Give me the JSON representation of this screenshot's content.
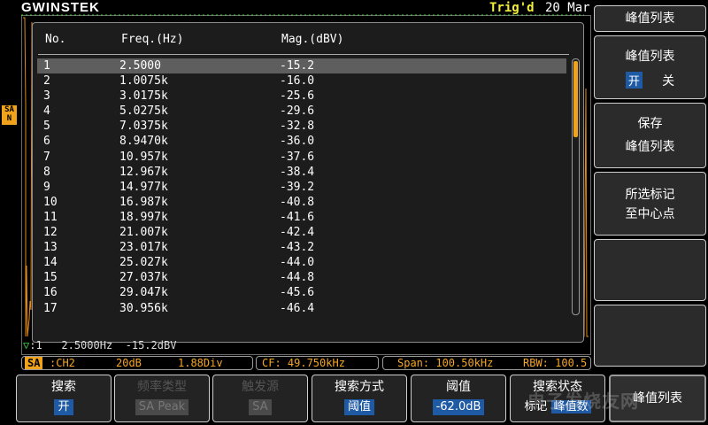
{
  "header": {
    "logo": "GWINSTEK",
    "trigger_status": "Trig'd",
    "date": "20 Mar"
  },
  "channel_marker": "SA\nN",
  "peak_table": {
    "col_no": "No.",
    "col_freq": "Freq.(Hz)",
    "col_mag": "Mag.(dBV)",
    "rows": [
      {
        "no": "1",
        "freq": "2.5000",
        "mag": "-15.2"
      },
      {
        "no": "2",
        "freq": "1.0075k",
        "mag": "-16.0"
      },
      {
        "no": "3",
        "freq": "3.0175k",
        "mag": "-25.6"
      },
      {
        "no": "4",
        "freq": "5.0275k",
        "mag": "-29.6"
      },
      {
        "no": "5",
        "freq": "7.0375k",
        "mag": "-32.8"
      },
      {
        "no": "6",
        "freq": "8.9470k",
        "mag": "-36.0"
      },
      {
        "no": "7",
        "freq": "10.957k",
        "mag": "-37.6"
      },
      {
        "no": "8",
        "freq": "12.967k",
        "mag": "-38.4"
      },
      {
        "no": "9",
        "freq": "14.977k",
        "mag": "-39.2"
      },
      {
        "no": "10",
        "freq": "16.987k",
        "mag": "-40.8"
      },
      {
        "no": "11",
        "freq": "18.997k",
        "mag": "-41.6"
      },
      {
        "no": "12",
        "freq": "21.007k",
        "mag": "-42.4"
      },
      {
        "no": "13",
        "freq": "23.017k",
        "mag": "-43.2"
      },
      {
        "no": "14",
        "freq": "25.027k",
        "mag": "-44.0"
      },
      {
        "no": "15",
        "freq": "27.037k",
        "mag": "-44.8"
      },
      {
        "no": "16",
        "freq": "29.047k",
        "mag": "-45.6"
      },
      {
        "no": "17",
        "freq": "30.956k",
        "mag": "-46.4"
      }
    ]
  },
  "marker_readout": {
    "index": ":1",
    "freq": "2.5000Hz",
    "mag": "-15.2dBV"
  },
  "status": {
    "sa_tag": "SA",
    "source": ":CH2",
    "scale": "20dB",
    "div": "1.88Div",
    "cf": "CF: 49.750kHz",
    "span": "Span: 100.50kHz",
    "rbw": "RBW: 100.5"
  },
  "right_menu": {
    "title": "峰值列表",
    "peak_list_label": "峰值列表",
    "on": "开",
    "off": "关",
    "save_line1": "保存",
    "save_line2": "峰值列表",
    "center_line1": "所选标记",
    "center_line2": "至中心点"
  },
  "bottom_menu": {
    "search_title": "搜索",
    "search_value": "开",
    "freq_type_title": "频率类型",
    "freq_type_value": "SA Peak",
    "trigger_source_title": "触发源",
    "trigger_source_value": "SA",
    "search_mode_title": "搜索方式",
    "search_mode_value": "阈值",
    "threshold_title": "阈值",
    "threshold_value": "-62.0dB",
    "search_state_title": "搜索状态",
    "search_state_prefix": "标记",
    "search_state_value": "峰值数",
    "peak_list_button": "峰值列表"
  },
  "watermark": "电子发烧友网"
}
